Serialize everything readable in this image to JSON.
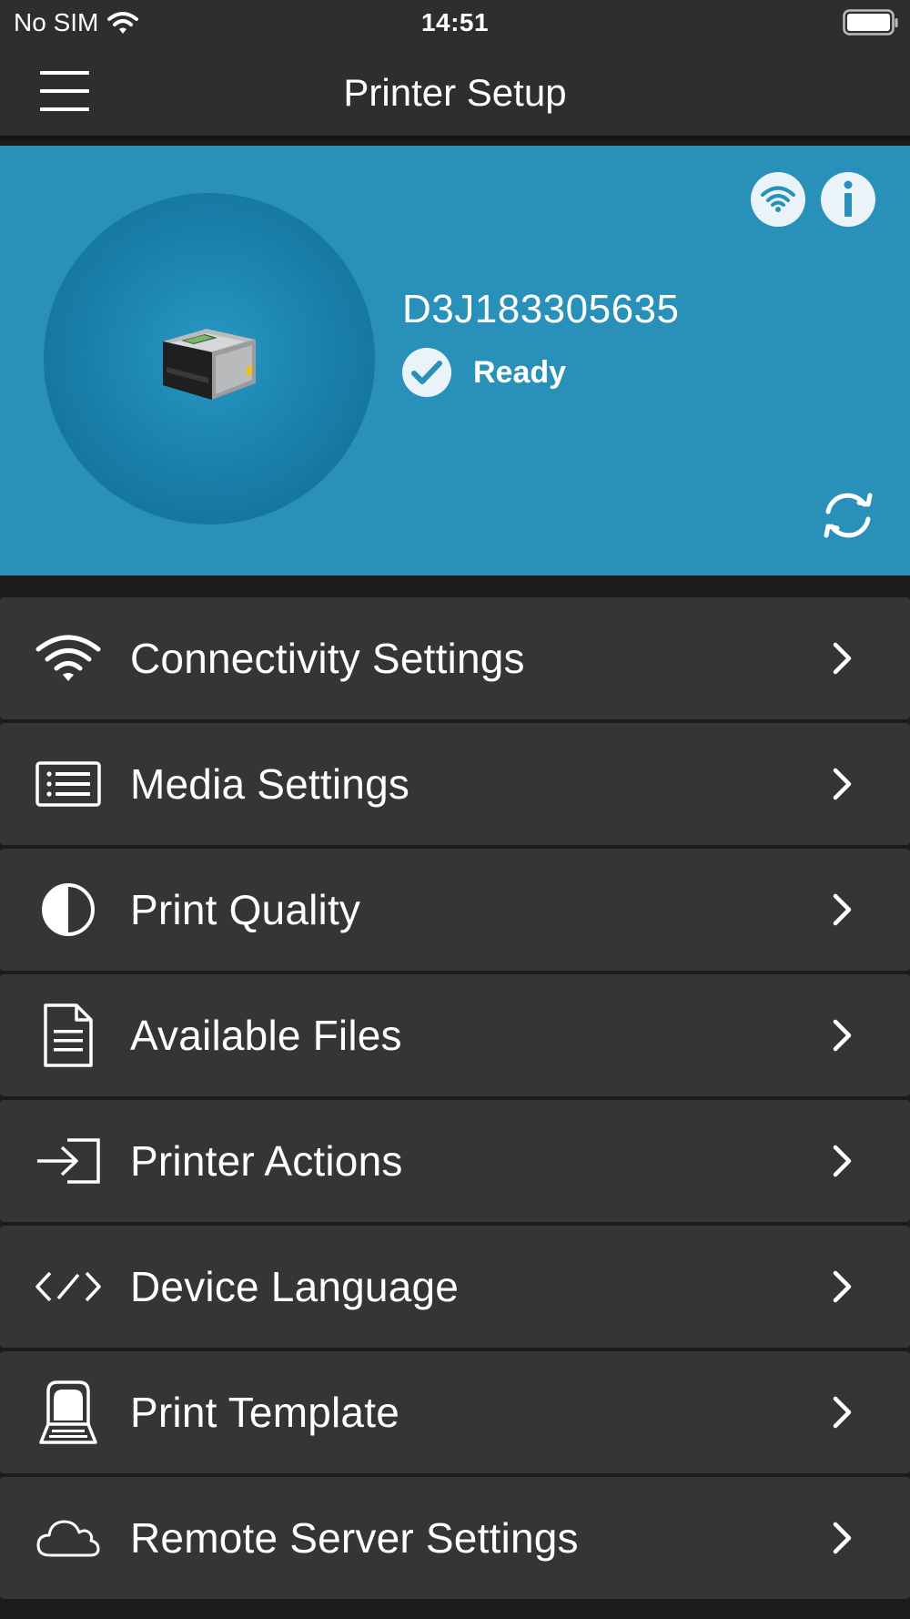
{
  "status_bar": {
    "carrier": "No SIM",
    "time": "14:51"
  },
  "nav": {
    "title": "Printer Setup"
  },
  "printer": {
    "name": "D3J183305635",
    "status": "Ready"
  },
  "settings": [
    {
      "label": "Connectivity Settings",
      "icon": "wifi-icon"
    },
    {
      "label": "Media Settings",
      "icon": "list-icon"
    },
    {
      "label": "Print Quality",
      "icon": "contrast-icon"
    },
    {
      "label": "Available Files",
      "icon": "file-icon"
    },
    {
      "label": "Printer Actions",
      "icon": "sign-in-icon"
    },
    {
      "label": "Device Language",
      "icon": "code-icon"
    },
    {
      "label": "Print Template",
      "icon": "printer-template-icon"
    },
    {
      "label": "Remote Server Settings",
      "icon": "cloud-icon"
    }
  ],
  "colors": {
    "card_bg": "#2991b9",
    "row_bg": "#353535",
    "page_bg": "#1c1c1c",
    "bar_bg": "#2e2e2e"
  }
}
